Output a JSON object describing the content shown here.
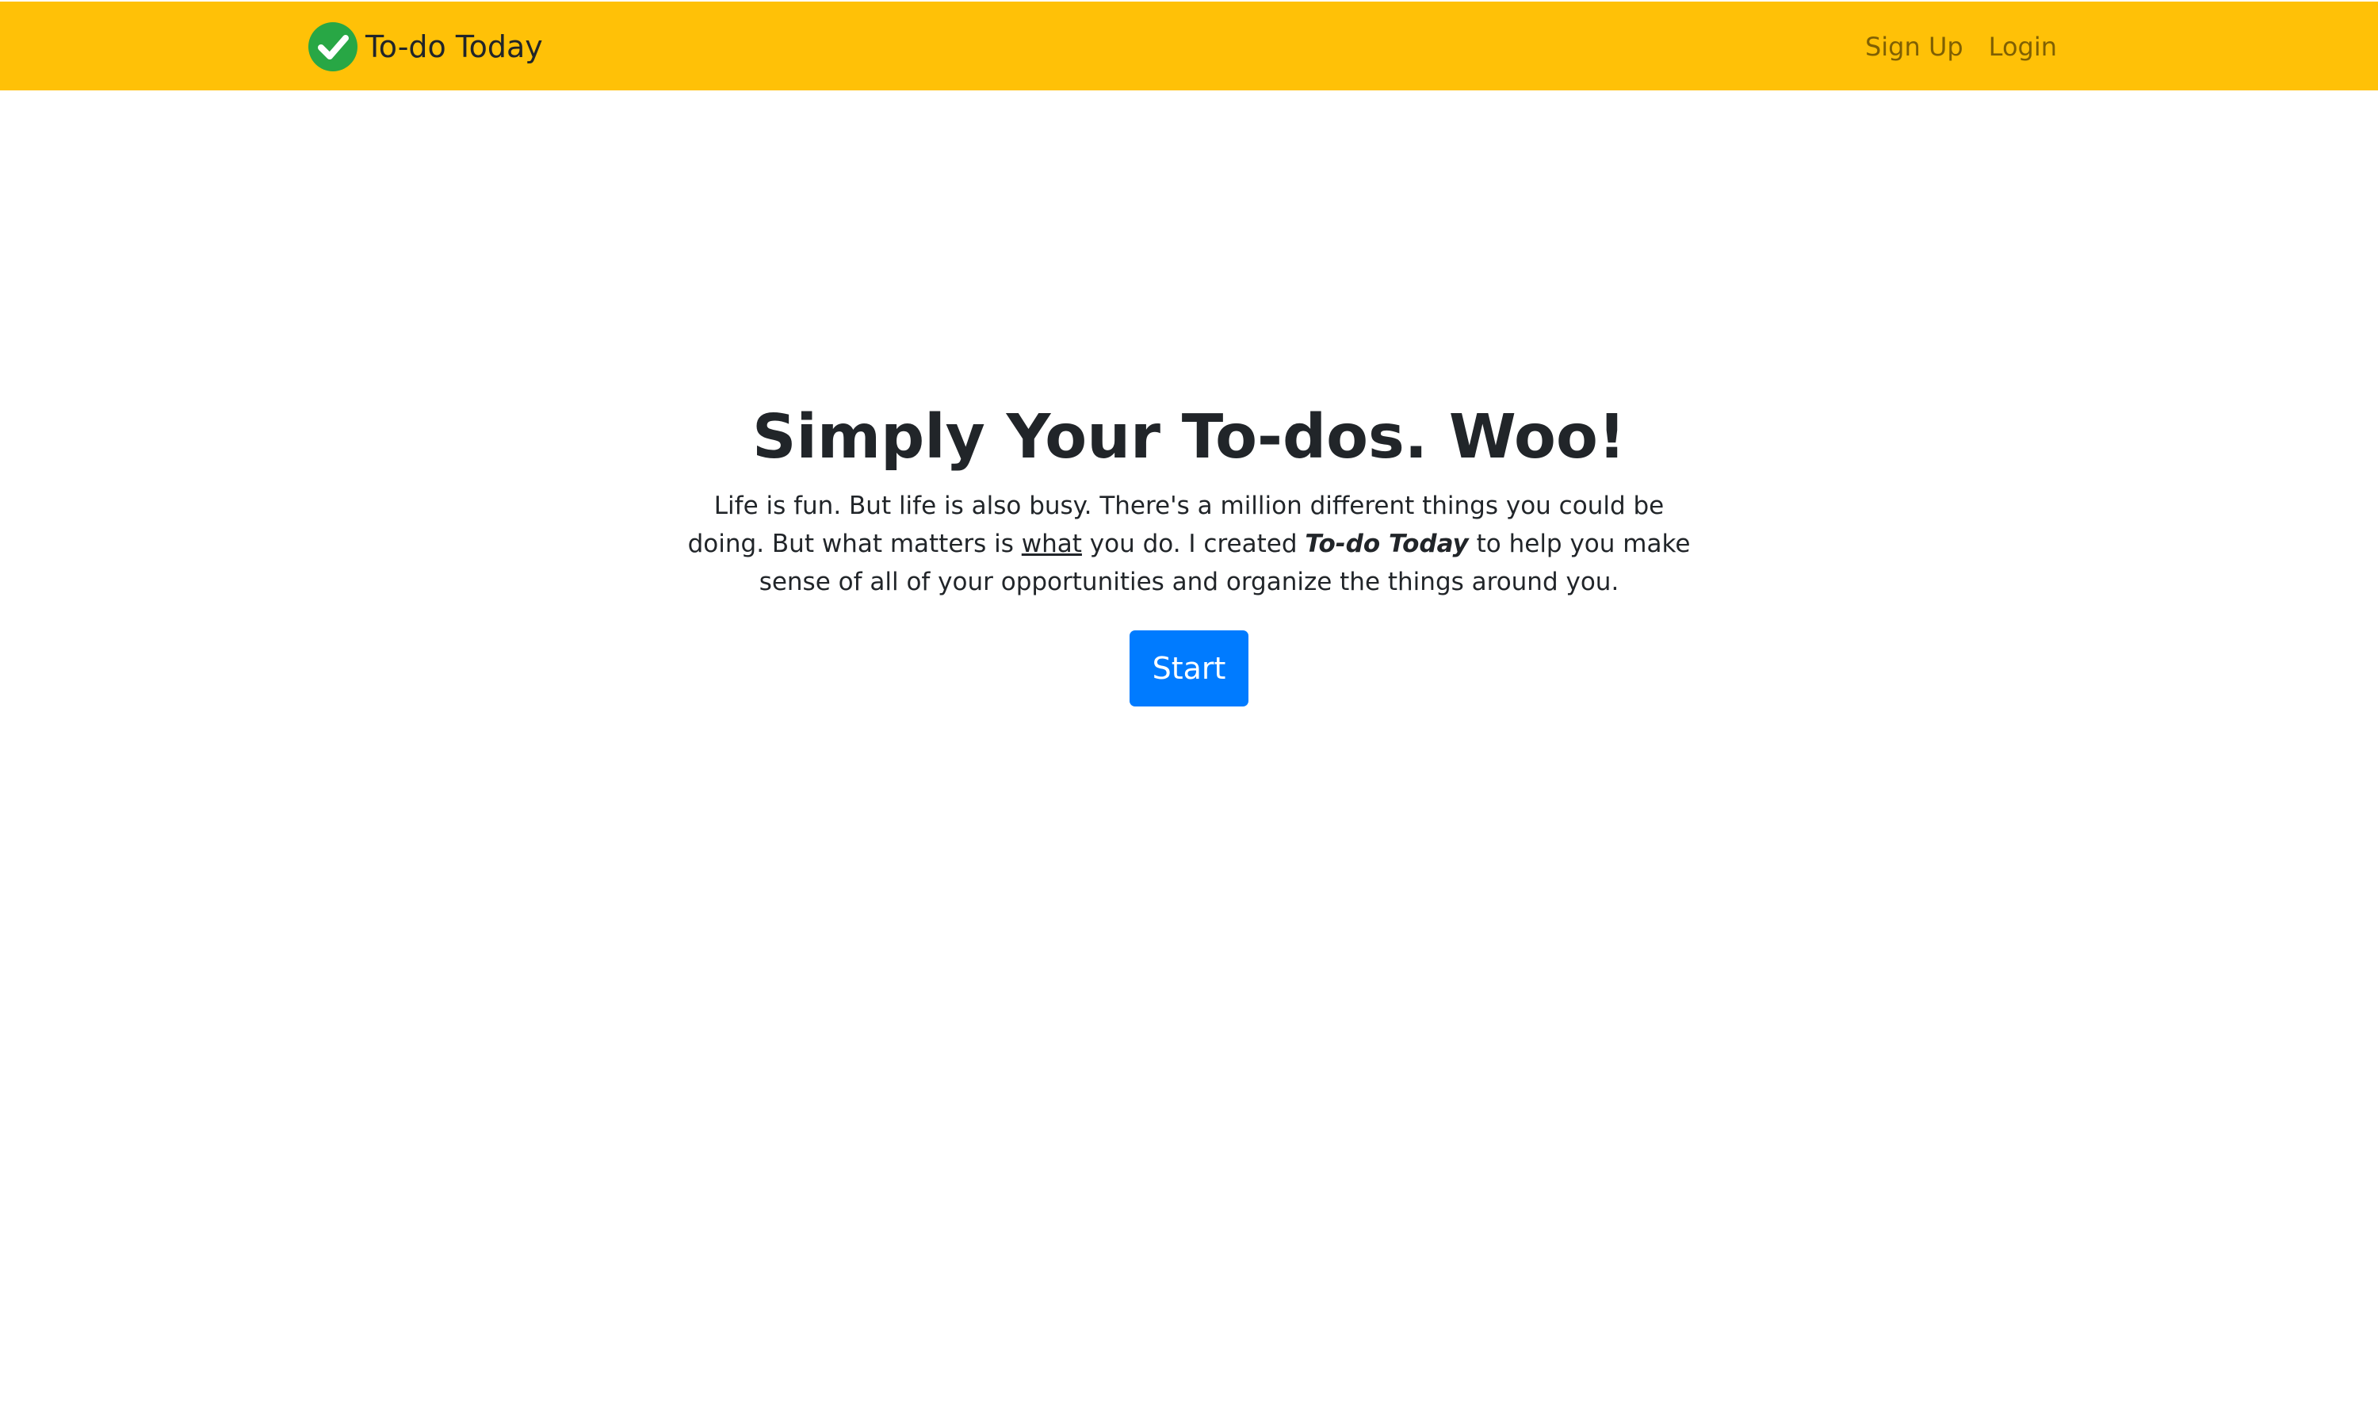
{
  "navbar": {
    "background": "#ffc107",
    "brand_icon": "check-circle-icon",
    "brand_icon_color": "#28a745",
    "brand_label": "To-do Today",
    "links": [
      {
        "label": "Sign Up"
      },
      {
        "label": "Login"
      }
    ]
  },
  "hero": {
    "title": "Simply Your To-dos. Woo!",
    "text_part1": "Life is fun. But life is also busy. There's a million different things you could be doing. But what matters is ",
    "text_underlined": "what",
    "text_part2": " you do. I created ",
    "text_emphasis": "To-do Today",
    "text_part3": " to help you make sense of all of your opportunities and organize the things around you.",
    "start_label": "Start",
    "start_color": "#007bff"
  }
}
